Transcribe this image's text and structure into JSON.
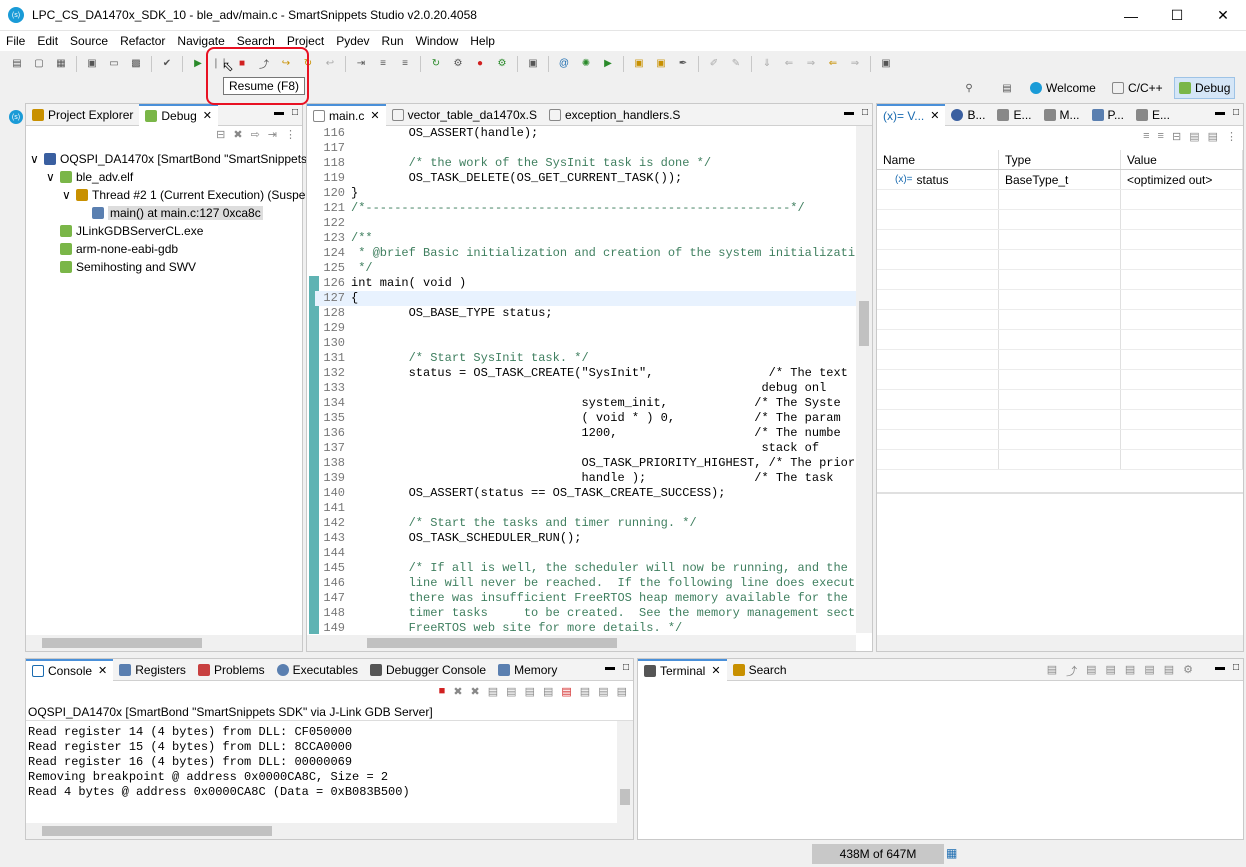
{
  "window": {
    "title": "LPC_CS_DA1470x_SDK_10 - ble_adv/main.c - SmartSnippets Studio v2.0.20.4058",
    "app_icon": "smartsnippets-icon"
  },
  "menu": [
    "File",
    "Edit",
    "Source",
    "Refactor",
    "Navigate",
    "Search",
    "Project",
    "Pydev",
    "Run",
    "Window",
    "Help"
  ],
  "tooltip": "Resume (F8)",
  "perspectives": {
    "welcome": "Welcome",
    "cc": "C/C++",
    "debug": "Debug"
  },
  "left_panel": {
    "tabs": [
      "Project Explorer",
      "Debug"
    ],
    "tree": [
      "OQSPI_DA1470x [SmartBond \"SmartSnippets",
      "ble_adv.elf",
      "Thread #2 1 (Current Execution) (Suspe",
      "main() at main.c:127 0xca8c",
      "JLinkGDBServerCL.exe",
      "arm-none-eabi-gdb",
      "Semihosting and SWV"
    ]
  },
  "editor": {
    "tabs": [
      "main.c",
      "vector_table_da1470x.S",
      "exception_handlers.S"
    ],
    "lines": [
      {
        "n": "116",
        "t": "        OS_ASSERT(handle);"
      },
      {
        "n": "117",
        "t": ""
      },
      {
        "n": "118",
        "t": "        /* the work of the SysInit task is done */"
      },
      {
        "n": "119",
        "t": "        OS_TASK_DELETE(OS_GET_CURRENT_TASK());"
      },
      {
        "n": "120",
        "t": "}"
      },
      {
        "n": "121",
        "t": "/*-----------------------------------------------------------*/"
      },
      {
        "n": "122",
        "t": ""
      },
      {
        "n": "123",
        "t": "/**"
      },
      {
        "n": "124",
        "t": " * @brief Basic initialization and creation of the system initializati"
      },
      {
        "n": "125",
        "t": " */"
      },
      {
        "n": "126",
        "t": "int main( void )"
      },
      {
        "n": "127",
        "t": "{"
      },
      {
        "n": "128",
        "t": "        OS_BASE_TYPE status;"
      },
      {
        "n": "129",
        "t": ""
      },
      {
        "n": "130",
        "t": ""
      },
      {
        "n": "131",
        "t": "        /* Start SysInit task. */"
      },
      {
        "n": "132",
        "t": "        status = OS_TASK_CREATE(\"SysInit\",                /* The text"
      },
      {
        "n": "133",
        "t": "                                                         debug onl"
      },
      {
        "n": "134",
        "t": "                                system_init,            /* The Syste"
      },
      {
        "n": "135",
        "t": "                                ( void * ) 0,           /* The param"
      },
      {
        "n": "136",
        "t": "                                1200,                   /* The numbe"
      },
      {
        "n": "137",
        "t": "                                                         stack of"
      },
      {
        "n": "138",
        "t": "                                OS_TASK_PRIORITY_HIGHEST, /* The prior"
      },
      {
        "n": "139",
        "t": "                                handle );               /* The task"
      },
      {
        "n": "140",
        "t": "        OS_ASSERT(status == OS_TASK_CREATE_SUCCESS);"
      },
      {
        "n": "141",
        "t": ""
      },
      {
        "n": "142",
        "t": "        /* Start the tasks and timer running. */"
      },
      {
        "n": "143",
        "t": "        OS_TASK_SCHEDULER_RUN();"
      },
      {
        "n": "144",
        "t": ""
      },
      {
        "n": "145",
        "t": "        /* If all is well, the scheduler will now be running, and the"
      },
      {
        "n": "146",
        "t": "        line will never be reached.  If the following line does execut"
      },
      {
        "n": "147",
        "t": "        there was insufficient FreeRTOS heap memory available for the"
      },
      {
        "n": "148",
        "t": "        timer tasks     to be created.  See the memory management sect"
      },
      {
        "n": "149",
        "t": "        FreeRTOS web site for more details. */"
      }
    ]
  },
  "variables": {
    "tabs": [
      "(x)= V...",
      "B...",
      "E...",
      "M...",
      "P...",
      "E..."
    ],
    "columns": [
      "Name",
      "Type",
      "Value"
    ],
    "rows": [
      {
        "name": "status",
        "type": "BaseType_t",
        "value": "<optimized out>"
      }
    ]
  },
  "console": {
    "tabs": [
      "Console",
      "Registers",
      "Problems",
      "Executables",
      "Debugger Console",
      "Memory"
    ],
    "header": "OQSPI_DA1470x [SmartBond \"SmartSnippets SDK\" via J-Link GDB Server]",
    "lines": [
      "Read register 14 (4 bytes) from DLL: CF050000",
      "Read register 15 (4 bytes) from DLL: 8CCA0000",
      "Read register 16 (4 bytes) from DLL: 00000069",
      "Removing breakpoint @ address 0x0000CA8C, Size = 2",
      "Read 4 bytes @ address 0x0000CA8C (Data = 0xB083B500)"
    ]
  },
  "terminal": {
    "tabs": [
      "Terminal",
      "Search"
    ]
  },
  "status": {
    "memory": "438M of 647M"
  }
}
